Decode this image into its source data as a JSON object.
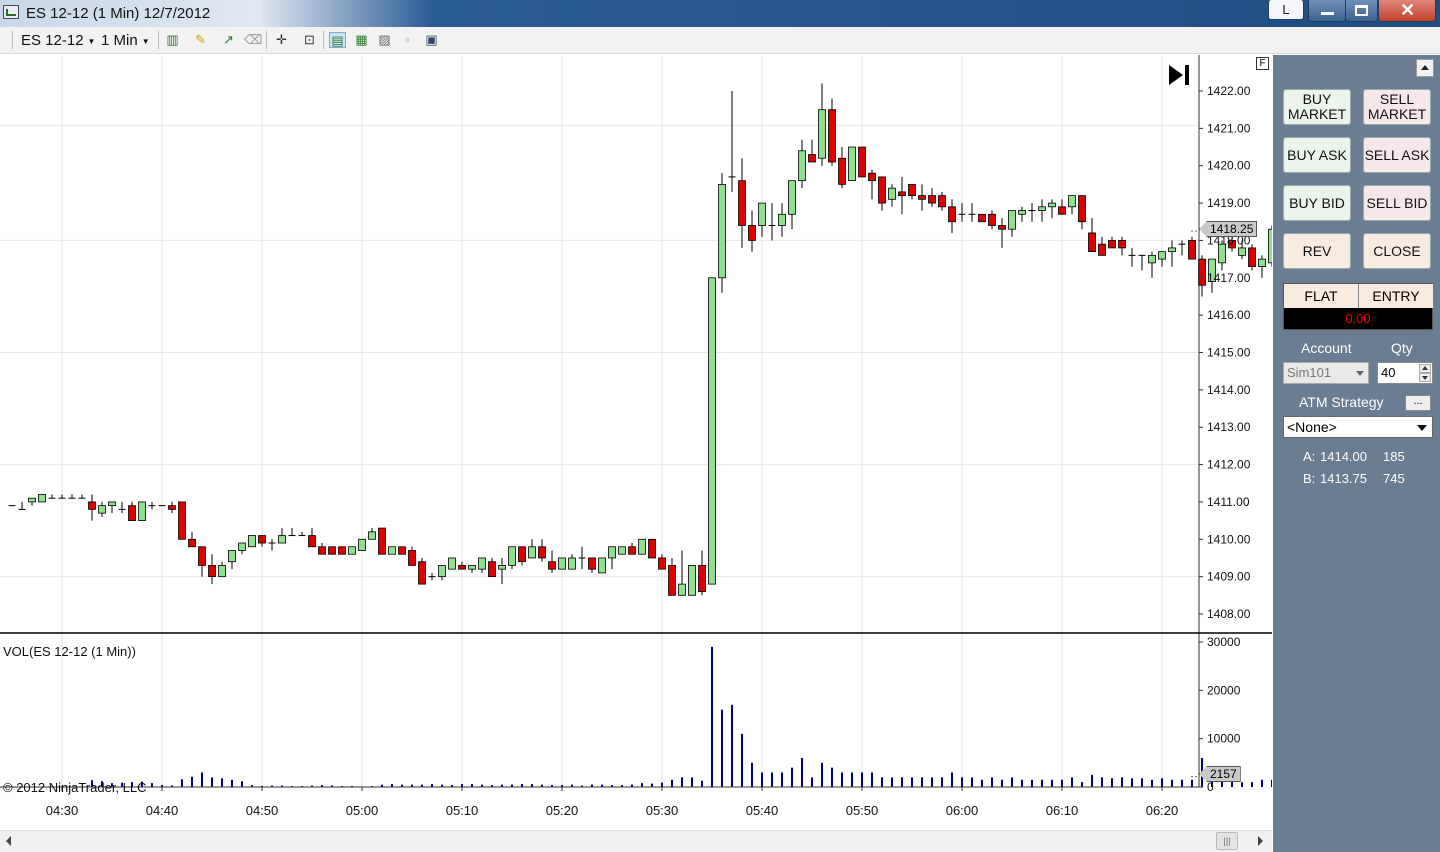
{
  "window": {
    "title": "ES 12-12 (1 Min)  12/7/2012",
    "lock_label": "L"
  },
  "toolbar": {
    "instrument": "ES 12-12",
    "interval": "1 Min"
  },
  "chart": {
    "price_marker": "1418.25",
    "volume_marker": "2157",
    "volume_label": "VOL(ES 12-12 (1 Min))",
    "copyright": "© 2012 NinjaTrader, LLC",
    "f_box": "F",
    "y_ticks": [
      "1422.00",
      "1421.00",
      "1420.00",
      "1419.00",
      "1418.00",
      "1417.00",
      "1416.00",
      "1415.00",
      "1414.00",
      "1413.00",
      "1412.00",
      "1411.00",
      "1410.00",
      "1409.00",
      "1408.00"
    ],
    "volume_ticks": [
      "30000",
      "20000",
      "10000",
      "0"
    ],
    "x_ticks": [
      "04:30",
      "04:40",
      "04:50",
      "05:00",
      "05:10",
      "05:20",
      "05:30",
      "05:40",
      "05:50",
      "06:00",
      "06:10",
      "06:20"
    ]
  },
  "chart_data": {
    "type": "candlestick",
    "instrument": "ES 12-12",
    "interval": "1 Min",
    "date": "12/7/2012",
    "x_range": [
      "04:25",
      "06:23"
    ],
    "price_ylim": [
      1407.6,
      1422.6
    ],
    "volume_ylim": [
      0,
      30000
    ],
    "start_time": "04:25",
    "ohlc": [
      [
        1410.9,
        1410.9,
        1410.9,
        1410.9
      ],
      [
        1410.8,
        1411.0,
        1410.8,
        1410.8
      ],
      [
        1411.0,
        1411.1,
        1410.9,
        1411.1
      ],
      [
        1411.0,
        1411.2,
        1411.0,
        1411.2
      ],
      [
        1411.1,
        1411.2,
        1411.1,
        1411.1
      ],
      [
        1411.1,
        1411.2,
        1411.1,
        1411.1
      ],
      [
        1411.1,
        1411.2,
        1411.1,
        1411.1
      ],
      [
        1411.1,
        1411.2,
        1411.1,
        1411.1
      ],
      [
        1411.0,
        1411.2,
        1410.5,
        1410.8
      ],
      [
        1410.7,
        1411.0,
        1410.6,
        1410.9
      ],
      [
        1410.9,
        1411.0,
        1410.7,
        1411.0
      ],
      [
        1410.8,
        1411.0,
        1410.7,
        1410.8
      ],
      [
        1410.9,
        1411.0,
        1410.5,
        1410.5
      ],
      [
        1410.5,
        1411.0,
        1410.5,
        1411.0
      ],
      [
        1410.9,
        1411.0,
        1410.8,
        1410.9
      ],
      [
        1410.9,
        1410.9,
        1410.9,
        1410.9
      ],
      [
        1410.9,
        1411.0,
        1410.7,
        1410.8
      ],
      [
        1411.0,
        1411.0,
        1410.0,
        1410.0
      ],
      [
        1410.0,
        1410.2,
        1409.8,
        1409.8
      ],
      [
        1409.8,
        1409.8,
        1409.0,
        1409.3
      ],
      [
        1409.3,
        1409.6,
        1408.8,
        1409.0
      ],
      [
        1409.0,
        1409.4,
        1409.0,
        1409.3
      ],
      [
        1409.4,
        1409.7,
        1409.2,
        1409.7
      ],
      [
        1409.7,
        1409.9,
        1409.6,
        1409.9
      ],
      [
        1409.8,
        1410.1,
        1409.8,
        1410.1
      ],
      [
        1410.1,
        1410.1,
        1409.8,
        1409.9
      ],
      [
        1409.9,
        1410.0,
        1409.7,
        1409.9
      ],
      [
        1409.9,
        1410.3,
        1409.9,
        1410.1
      ],
      [
        1410.1,
        1410.3,
        1410.1,
        1410.1
      ],
      [
        1410.1,
        1410.2,
        1410.1,
        1410.1
      ],
      [
        1410.1,
        1410.3,
        1409.9,
        1409.8
      ],
      [
        1409.8,
        1409.9,
        1409.6,
        1409.6
      ],
      [
        1409.8,
        1409.8,
        1409.6,
        1409.6
      ],
      [
        1409.8,
        1409.8,
        1409.6,
        1409.6
      ],
      [
        1409.6,
        1409.8,
        1409.6,
        1409.8
      ],
      [
        1409.7,
        1410.0,
        1409.7,
        1410.0
      ],
      [
        1410.0,
        1410.3,
        1410.0,
        1410.2
      ],
      [
        1410.3,
        1410.3,
        1409.6,
        1409.6
      ],
      [
        1409.6,
        1409.8,
        1409.6,
        1409.8
      ],
      [
        1409.8,
        1409.8,
        1409.6,
        1409.6
      ],
      [
        1409.7,
        1409.8,
        1409.3,
        1409.3
      ],
      [
        1409.4,
        1409.5,
        1408.8,
        1408.8
      ],
      [
        1409.0,
        1409.1,
        1408.9,
        1409.0
      ],
      [
        1409.0,
        1409.3,
        1408.9,
        1409.3
      ],
      [
        1409.2,
        1409.5,
        1409.2,
        1409.5
      ],
      [
        1409.3,
        1409.4,
        1409.2,
        1409.2
      ],
      [
        1409.2,
        1409.3,
        1409.1,
        1409.3
      ],
      [
        1409.2,
        1409.5,
        1409.1,
        1409.5
      ],
      [
        1409.4,
        1409.5,
        1409.0,
        1409.0
      ],
      [
        1409.2,
        1409.5,
        1408.8,
        1409.3
      ],
      [
        1409.3,
        1409.8,
        1409.2,
        1409.8
      ],
      [
        1409.8,
        1409.8,
        1409.3,
        1409.4
      ],
      [
        1409.5,
        1410.0,
        1409.5,
        1409.8
      ],
      [
        1409.8,
        1410.0,
        1409.4,
        1409.5
      ],
      [
        1409.4,
        1409.7,
        1409.1,
        1409.2
      ],
      [
        1409.2,
        1409.5,
        1409.2,
        1409.5
      ],
      [
        1409.2,
        1409.6,
        1409.2,
        1409.5
      ],
      [
        1409.5,
        1409.8,
        1409.2,
        1409.5
      ],
      [
        1409.5,
        1409.5,
        1409.1,
        1409.2
      ],
      [
        1409.1,
        1409.5,
        1409.1,
        1409.5
      ],
      [
        1409.5,
        1409.8,
        1409.2,
        1409.8
      ],
      [
        1409.6,
        1409.8,
        1409.6,
        1409.8
      ],
      [
        1409.8,
        1409.9,
        1409.6,
        1409.6
      ],
      [
        1409.6,
        1410.0,
        1409.6,
        1410.0
      ],
      [
        1410.0,
        1410.0,
        1409.5,
        1409.5
      ],
      [
        1409.5,
        1409.6,
        1409.2,
        1409.2
      ],
      [
        1409.3,
        1409.5,
        1408.5,
        1408.5
      ],
      [
        1408.5,
        1409.7,
        1408.5,
        1408.8
      ],
      [
        1408.5,
        1409.3,
        1408.5,
        1409.3
      ],
      [
        1409.3,
        1409.7,
        1408.5,
        1408.6
      ],
      [
        1408.8,
        1417.0,
        1408.8,
        1417.0
      ],
      [
        1417.0,
        1419.8,
        1416.6,
        1419.5
      ],
      [
        1419.7,
        1422.0,
        1419.3,
        1419.7
      ],
      [
        1419.6,
        1420.2,
        1417.8,
        1418.4
      ],
      [
        1418.4,
        1418.8,
        1417.7,
        1418.0
      ],
      [
        1418.4,
        1419.0,
        1418.1,
        1419.0
      ],
      [
        1418.4,
        1419.0,
        1418.0,
        1418.4
      ],
      [
        1418.4,
        1419.0,
        1418.1,
        1418.7
      ],
      [
        1418.7,
        1419.6,
        1418.3,
        1419.6
      ],
      [
        1419.6,
        1420.7,
        1419.4,
        1420.4
      ],
      [
        1420.3,
        1420.7,
        1420.1,
        1420.1
      ],
      [
        1420.2,
        1422.2,
        1420.0,
        1421.5
      ],
      [
        1421.5,
        1421.8,
        1420.0,
        1420.1
      ],
      [
        1420.2,
        1420.5,
        1419.4,
        1419.5
      ],
      [
        1419.6,
        1420.5,
        1419.6,
        1420.5
      ],
      [
        1420.5,
        1420.5,
        1419.7,
        1419.7
      ],
      [
        1419.8,
        1419.9,
        1419.1,
        1419.6
      ],
      [
        1419.7,
        1419.7,
        1418.8,
        1419.0
      ],
      [
        1419.1,
        1419.5,
        1418.9,
        1419.4
      ],
      [
        1419.3,
        1419.7,
        1418.7,
        1419.2
      ],
      [
        1419.5,
        1419.5,
        1419.1,
        1419.2
      ],
      [
        1419.2,
        1419.5,
        1418.8,
        1419.1
      ],
      [
        1419.2,
        1419.4,
        1418.9,
        1419.0
      ],
      [
        1419.2,
        1419.3,
        1418.8,
        1418.9
      ],
      [
        1418.9,
        1419.1,
        1418.2,
        1418.5
      ],
      [
        1418.7,
        1419.0,
        1418.5,
        1418.7
      ],
      [
        1418.7,
        1419.0,
        1418.5,
        1418.7
      ],
      [
        1418.7,
        1418.7,
        1418.5,
        1418.5
      ],
      [
        1418.7,
        1418.8,
        1418.3,
        1418.4
      ],
      [
        1418.4,
        1418.6,
        1417.8,
        1418.3
      ],
      [
        1418.3,
        1418.8,
        1418.1,
        1418.8
      ],
      [
        1418.7,
        1418.9,
        1418.5,
        1418.8
      ],
      [
        1418.8,
        1419.0,
        1418.5,
        1418.8
      ],
      [
        1418.8,
        1419.1,
        1418.5,
        1418.9
      ],
      [
        1418.9,
        1419.1,
        1418.6,
        1419.0
      ],
      [
        1418.9,
        1419.1,
        1418.7,
        1418.7
      ],
      [
        1418.9,
        1419.2,
        1418.7,
        1419.2
      ],
      [
        1419.2,
        1419.2,
        1418.3,
        1418.5
      ],
      [
        1418.2,
        1418.6,
        1417.9,
        1417.7
      ],
      [
        1417.9,
        1418.1,
        1417.6,
        1417.6
      ],
      [
        1418.0,
        1418.1,
        1417.8,
        1417.8
      ],
      [
        1418.0,
        1418.1,
        1417.6,
        1417.8
      ],
      [
        1417.6,
        1417.8,
        1417.3,
        1417.6
      ],
      [
        1417.6,
        1417.6,
        1417.2,
        1417.6
      ],
      [
        1417.4,
        1417.7,
        1417.0,
        1417.6
      ],
      [
        1417.5,
        1417.7,
        1417.3,
        1417.7
      ],
      [
        1417.7,
        1418.0,
        1417.3,
        1417.8
      ],
      [
        1417.9,
        1418.0,
        1417.6,
        1417.9
      ],
      [
        1418.0,
        1418.1,
        1417.5,
        1417.5
      ],
      [
        1417.5,
        1417.6,
        1416.5,
        1416.8
      ],
      [
        1416.9,
        1417.5,
        1416.6,
        1417.5
      ],
      [
        1417.4,
        1418.0,
        1417.2,
        1417.9
      ],
      [
        1418.0,
        1418.3,
        1417.7,
        1417.8
      ],
      [
        1417.6,
        1418.0,
        1417.5,
        1417.8
      ],
      [
        1417.8,
        1417.9,
        1417.2,
        1417.3
      ],
      [
        1417.3,
        1417.6,
        1417.0,
        1417.5
      ],
      [
        1417.4,
        1418.4,
        1417.3,
        1418.3
      ],
      [
        1418.1,
        1418.5,
        1417.9,
        1418.4
      ]
    ],
    "volume": [
      150,
      100,
      80,
      60,
      60,
      60,
      60,
      60,
      1400,
      1200,
      800,
      900,
      1000,
      1100,
      800,
      400,
      300,
      1600,
      2100,
      3000,
      2000,
      1800,
      1500,
      1200,
      400,
      200,
      300,
      300,
      200,
      200,
      300,
      400,
      300,
      200,
      200,
      100,
      200,
      500,
      600,
      500,
      500,
      500,
      600,
      500,
      400,
      600,
      600,
      500,
      400,
      500,
      500,
      600,
      600,
      500,
      400,
      400,
      500,
      300,
      500,
      500,
      400,
      400,
      500,
      800,
      700,
      900,
      1500,
      2000,
      2000,
      1300,
      29000,
      16000,
      17000,
      11000,
      5000,
      3000,
      3000,
      3000,
      4000,
      6000,
      2000,
      5000,
      4000,
      3000,
      3000,
      3000,
      3000,
      2000,
      2000,
      2000,
      2000,
      2000,
      2000,
      2000,
      3000,
      2000,
      2000,
      1500,
      2000,
      1500,
      2000,
      1500,
      1500,
      1500,
      1500,
      1500,
      2000,
      1000,
      2500,
      2000,
      1800,
      2000,
      1800,
      1800,
      1500,
      1800,
      1500,
      1500,
      1500,
      6000,
      2500,
      2000,
      1500,
      1000,
      1000,
      1500,
      1500,
      2157
    ],
    "current_price": 1418.25,
    "current_volume": 2157
  },
  "panel": {
    "buy_market": "BUY MARKET",
    "sell_market": "SELL MARKET",
    "buy_ask": "BUY ASK",
    "sell_ask": "SELL ASK",
    "buy_bid": "BUY BID",
    "sell_bid": "SELL BID",
    "rev": "REV",
    "close": "CLOSE",
    "position": "FLAT",
    "entry": "ENTRY",
    "pnl": "0.00",
    "account_label": "Account",
    "qty_label": "Qty",
    "account_value": "Sim101",
    "qty_value": "40",
    "atm_label": "ATM Strategy",
    "atm_more": "...",
    "atm_value": "<None>",
    "ask_label": "A:",
    "ask_price": "1414.00",
    "ask_size": "185",
    "bid_label": "B:",
    "bid_price": "1413.75",
    "bid_size": "745"
  },
  "colors": {
    "up": "#90e090",
    "down": "#dd0000",
    "volume": "#00008b",
    "panel": "#6b7d93"
  },
  "icons": [
    "chart-style-icon",
    "pencil-icon",
    "draw-tool-icon",
    "eraser-icon",
    "crosshair-icon",
    "zoom-icon",
    "strategy-icon",
    "indicator-icon",
    "data-box-icon",
    "properties-icon",
    "window-icon",
    "go-to-end-icon",
    "scroll-thumb-icon"
  ]
}
